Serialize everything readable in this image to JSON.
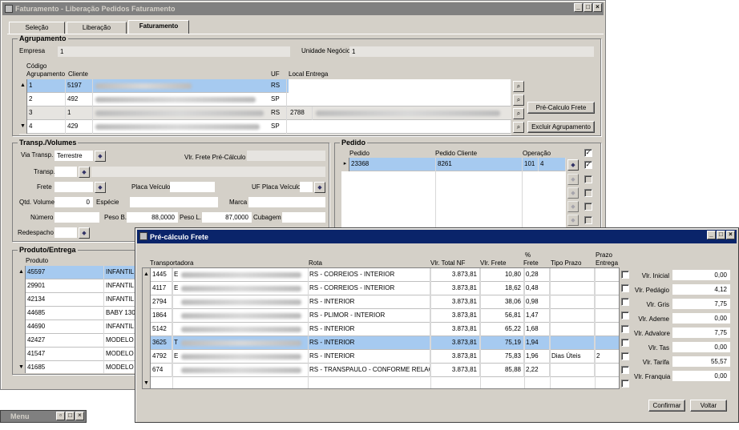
{
  "main_window": {
    "title": "Faturamento - Liberação Pedidos Faturamento",
    "tabs": [
      {
        "label": "Seleção"
      },
      {
        "label": "Liberação"
      },
      {
        "label": "Faturamento"
      }
    ],
    "active_tab": "Faturamento"
  },
  "agrupamento": {
    "title": "Agrupamento",
    "empresa_label": "Empresa",
    "empresa_value": "1",
    "unidade_label": "Unidade Negócio",
    "unidade_value": "1",
    "headers": {
      "codigo": "Código",
      "agrupamento": "Agrupamento",
      "cliente": "Cliente",
      "uf": "UF",
      "local_entrega": "Local Entrega"
    },
    "rows": [
      {
        "codigo": "1",
        "cliente": "5197",
        "uf": "RS",
        "local": "",
        "selected": true
      },
      {
        "codigo": "2",
        "cliente": "492",
        "uf": "SP",
        "local": "",
        "selected": false
      },
      {
        "codigo": "3",
        "cliente": "1",
        "uf": "RS",
        "local": "2788",
        "selected": false
      },
      {
        "codigo": "4",
        "cliente": "429",
        "uf": "SP",
        "local": "",
        "selected": false
      }
    ],
    "btn_pre_calculo": "Pré-Calculo Frete",
    "btn_excluir": "Excluir Agrupamento"
  },
  "transp": {
    "title": "Transp./Volumes",
    "via_label": "Via Transp.",
    "via_value": "Terrestre",
    "vlr_frete_label": "Vlr. Frete Pré-Cálculo",
    "transp_label": "Transp.",
    "frete_label": "Frete",
    "placa_label": "Placa Veículo",
    "uf_placa_label": "UF Placa Veículo",
    "qtd_label": "Qtd. Volume",
    "qtd_value": "0",
    "especie_label": "Espécie",
    "marca_label": "Marca",
    "numero_label": "Número",
    "peso_b_label": "Peso B.",
    "peso_b_value": "88,0000",
    "peso_l_label": "Peso L.",
    "peso_l_value": "87,0000",
    "cubagem_label": "Cubagem",
    "redespacho_label": "Redespacho"
  },
  "pedido": {
    "title": "Pedido",
    "headers": {
      "pedido": "Pedido",
      "cliente": "Pedido Cliente",
      "operacao": "Operação"
    },
    "rows": [
      {
        "pedido": "23368",
        "cliente": "8261",
        "op1": "101",
        "op2": "4"
      }
    ]
  },
  "produto": {
    "title": "Produto/Entrega",
    "header": "Produto",
    "rows": [
      {
        "codigo": "45597",
        "desc": "INFANTIL",
        "selected": true
      },
      {
        "codigo": "29901",
        "desc": "INFANTIL",
        "selected": false
      },
      {
        "codigo": "42134",
        "desc": "INFANTIL",
        "selected": false
      },
      {
        "codigo": "44685",
        "desc": "BABY 130",
        "selected": false
      },
      {
        "codigo": "44690",
        "desc": "INFANTIL",
        "selected": false
      },
      {
        "codigo": "42427",
        "desc": "MODELO",
        "selected": false
      },
      {
        "codigo": "41547",
        "desc": "MODELO",
        "selected": false
      },
      {
        "codigo": "41685",
        "desc": "MODELO",
        "selected": false
      }
    ]
  },
  "menu_bar": {
    "title": "Menu"
  },
  "dialog": {
    "title": "Pré-cálculo Frete",
    "headers": {
      "transportadora": "Transportadora",
      "rota": "Rota",
      "vlr_total_nf": "Vlr. Total NF",
      "vlr_frete": "Vlr. Frete",
      "pct_top": "%",
      "pct_bottom": "Frete",
      "tipo_prazo": "Tipo Prazo",
      "prazo_top": "Prazo",
      "prazo_bottom": "Entrega"
    },
    "rows": [
      {
        "cod": "1445",
        "prefix": "E",
        "rota": "RS - CORREIOS - INTERIOR",
        "nf": "3.873,81",
        "frete": "10,80",
        "pct": "0,28",
        "tipo": "",
        "prazo": "",
        "selected": false
      },
      {
        "cod": "4117",
        "prefix": "E",
        "rota": "RS - CORREIOS - INTERIOR",
        "nf": "3.873,81",
        "frete": "18,62",
        "pct": "0,48",
        "tipo": "",
        "prazo": "",
        "selected": false
      },
      {
        "cod": "2794",
        "prefix": "",
        "rota": "RS - INTERIOR",
        "nf": "3.873,81",
        "frete": "38,06",
        "pct": "0,98",
        "tipo": "",
        "prazo": "",
        "selected": false
      },
      {
        "cod": "1864",
        "prefix": "",
        "rota": "RS - PLIMOR - INTERIOR",
        "nf": "3.873,81",
        "frete": "56,81",
        "pct": "1,47",
        "tipo": "",
        "prazo": "",
        "selected": false
      },
      {
        "cod": "5142",
        "prefix": "",
        "rota": "RS - INTERIOR",
        "nf": "3.873,81",
        "frete": "65,22",
        "pct": "1,68",
        "tipo": "",
        "prazo": "",
        "selected": false
      },
      {
        "cod": "3625",
        "prefix": "T",
        "rota": "RS - INTERIOR",
        "nf": "3.873,81",
        "frete": "75,19",
        "pct": "1,94",
        "tipo": "",
        "prazo": "",
        "selected": true
      },
      {
        "cod": "4792",
        "prefix": "E",
        "rota": "RS - INTERIOR",
        "nf": "3.873,81",
        "frete": "75,83",
        "pct": "1,96",
        "tipo": "Dias Úteis",
        "prazo": "2",
        "selected": false
      },
      {
        "cod": "674",
        "prefix": "",
        "rota": "RS - TRANSPAULO - CONFORME RELAÇÃ",
        "nf": "3.873,81",
        "frete": "85,88",
        "pct": "2,22",
        "tipo": "",
        "prazo": "",
        "selected": false
      }
    ],
    "side_fields": [
      {
        "label": "Vlr. Inicial",
        "value": "0,00"
      },
      {
        "label": "Vlr. Pedágio",
        "value": "4,12"
      },
      {
        "label": "Vlr. Gris",
        "value": "7,75"
      },
      {
        "label": "Vlr. Ademe",
        "value": "0,00"
      },
      {
        "label": "Vlr. Advalore",
        "value": "7,75"
      },
      {
        "label": "Vlr. Tas",
        "value": "0,00"
      },
      {
        "label": "Vlr. Tarifa",
        "value": "55,57"
      },
      {
        "label": "Vlr. Franquia",
        "value": "0,00"
      }
    ],
    "btn_confirmar": "Confirmar",
    "btn_voltar": "Voltar"
  }
}
